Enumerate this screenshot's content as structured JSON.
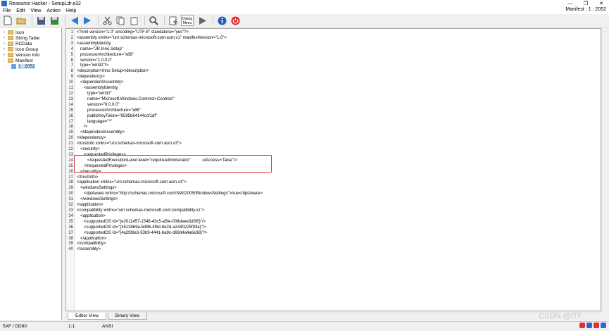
{
  "app": {
    "title": "Resource Hacker - SetupLdr.e32",
    "manifest_header": "Manifest : 1 : 2052"
  },
  "window_controls": {
    "minimize": "—",
    "maximize": "❐",
    "close": "✕"
  },
  "menu": [
    "File",
    "Edit",
    "View",
    "Action",
    "Help"
  ],
  "toolbar": {
    "dialog_label": "Dialog Menu",
    "icons": [
      "new-file-icon",
      "open-folder-icon",
      "save-icon",
      "save-as-icon",
      "back-arrow-icon",
      "forward-arrow-icon",
      "cut-icon",
      "copy-icon",
      "paste-icon",
      "find-icon",
      "add-resource-icon",
      "dialog-menu-icon",
      "run-script-icon",
      "info-icon",
      "power-icon"
    ]
  },
  "tree": {
    "items": [
      {
        "label": "Icon",
        "expander": "+"
      },
      {
        "label": "String Table",
        "expander": "+"
      },
      {
        "label": "RCData",
        "expander": "+"
      },
      {
        "label": "Icon Group",
        "expander": "+"
      },
      {
        "label": "Version Info",
        "expander": "+"
      },
      {
        "label": "Manifest",
        "expander": "−"
      },
      {
        "label": "1 : 2052",
        "expander": ""
      }
    ]
  },
  "editor": {
    "lines": [
      "<?xml version=\"1.0\" encoding=\"UTF-8\" standalone=\"yes\"?>",
      "<assembly xmlns=\"urn:schemas-microsoft-com:asm.v1\" manifestVersion=\"1.0\">",
      "<assemblyIdentity",
      "   name=\"JR.Inno.Setup\"",
      "   processorArchitecture=\"x86\"",
      "   version=\"1.0.0.0\"",
      "   type=\"win32\"/>",
      "<description>Inno Setup</description>",
      "<dependency>",
      "   <dependentAssembly>",
      "      <assemblyIdentity",
      "         type=\"win32\"",
      "         name=\"Microsoft.Windows.Common-Controls\"",
      "         version=\"6.0.0.0\"",
      "         processorArchitecture=\"x86\"",
      "         publicKeyToken=\"6595b64144ccf1df\"",
      "         language=\"*\"",
      "      />",
      "   </dependentAssembly>",
      "</dependency>",
      "<trustInfo xmlns=\"urn:schemas-microsoft-com:asm.v3\">",
      "   <security>",
      "      <requestedPrivileges>",
      "         <requestedExecutionLevel level=\"requireAdministrator\"          uiAccess=\"false\"/>",
      "      </requestedPrivileges>",
      "   </security>",
      "</trustInfo>",
      "<application xmlns=\"urn:schemas-microsoft-com:asm.v3\">",
      "   <windowsSettings>",
      "      <dpiAware xmlns=\"http://schemas.microsoft.com/SMI/2005/WindowsSettings\">true</dpiAware>",
      "   </windowsSettings>",
      "</application>",
      "<compatibility xmlns=\"urn:schemas-microsoft-com:compatibility.v1\">",
      "   <application>",
      "      <supportedOS Id=\"{e2011457-1546-43c5-a5fe-008deee3d3f0}\"/>",
      "      <supportedOS Id=\"{35138b9a-5d96-4fbd-8e2d-a2440225f93a}\"/>",
      "      <supportedOS Id=\"{4a2f28e3-53b9-4441-ba9c-d69d4a4a6e38}\"/>",
      "   </application>",
      "</compatibility>",
      "</assembly>"
    ]
  },
  "tabs": [
    {
      "label": "Editor View",
      "active": true
    },
    {
      "label": "Binary View",
      "active": false
    }
  ],
  "status": {
    "offset": "5AF / DD90",
    "position": "1:1",
    "encoding": "ANSI"
  },
  "watermark": "CSDN @ITF.",
  "colors": {
    "highlight_border": "#e03030",
    "selection": "#cce4f7"
  }
}
